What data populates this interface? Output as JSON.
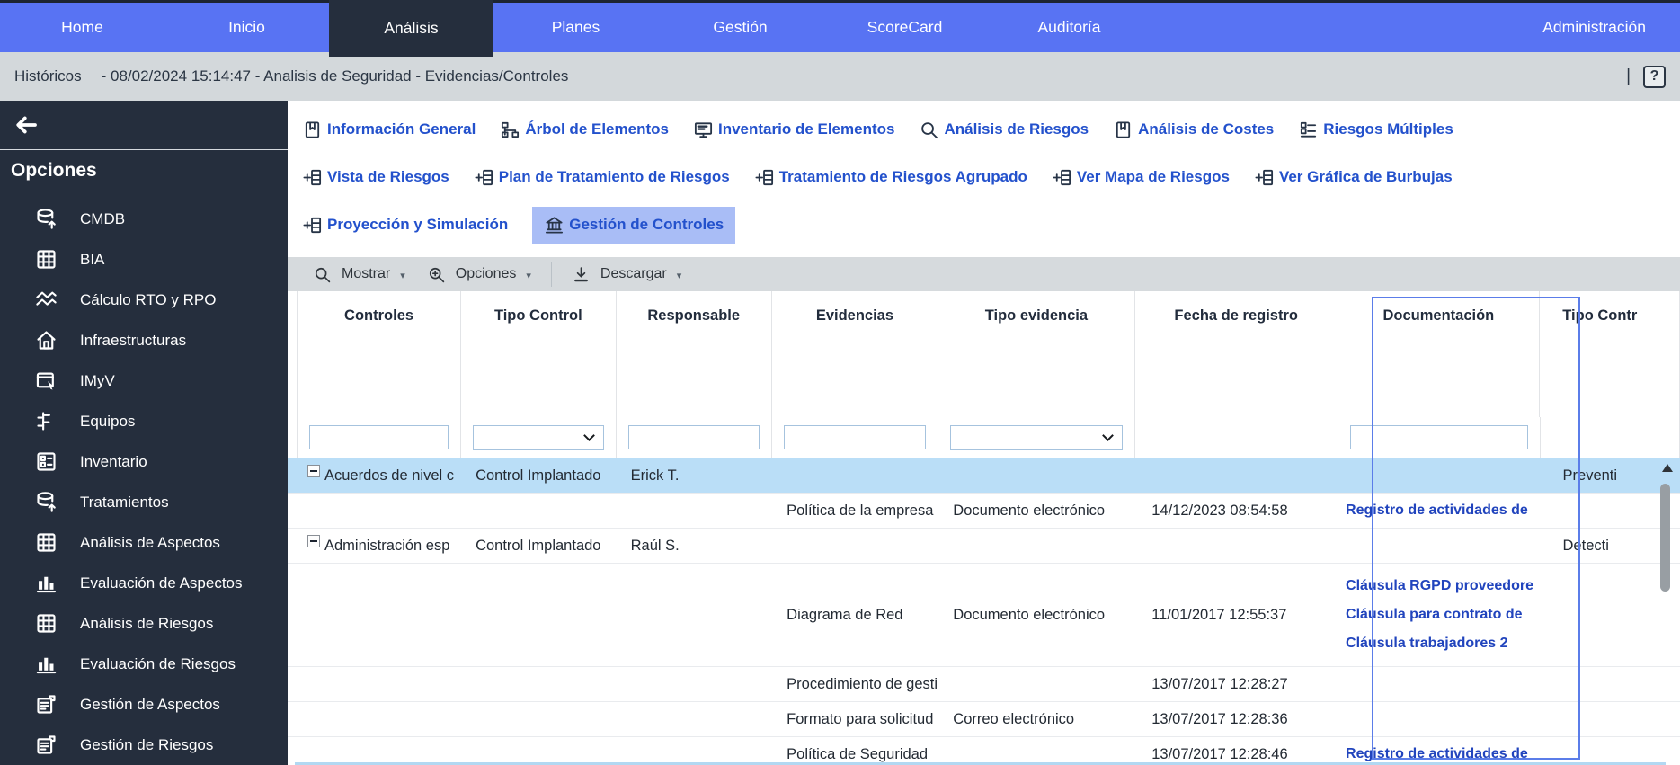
{
  "nav": {
    "items": [
      {
        "label": "Home"
      },
      {
        "label": "Inicio"
      },
      {
        "label": "Análisis",
        "active": true
      },
      {
        "label": "Planes"
      },
      {
        "label": "Gestión"
      },
      {
        "label": "ScoreCard"
      },
      {
        "label": "Auditoría"
      },
      {
        "label": "Administración",
        "right": true
      }
    ]
  },
  "breadcrumb": {
    "section": "Históricos",
    "detail": "- 08/02/2024 15:14:47 - Analisis de Seguridad - Evidencias/Controles",
    "separator": "|",
    "help_label": "?"
  },
  "sidebar": {
    "title": "Opciones",
    "items": [
      {
        "label": "CMDB",
        "icon": "database"
      },
      {
        "label": "BIA",
        "icon": "grid"
      },
      {
        "label": "Cálculo RTO y RPO",
        "icon": "trend"
      },
      {
        "label": "Infraestructuras",
        "icon": "home"
      },
      {
        "label": "IMyV",
        "icon": "calendar-cursor"
      },
      {
        "label": "Equipos",
        "icon": "hierarchy"
      },
      {
        "label": "Inventario",
        "icon": "checklist"
      },
      {
        "label": "Tratamientos",
        "icon": "database"
      },
      {
        "label": "Análisis de Aspectos",
        "icon": "grid"
      },
      {
        "label": "Evaluación de Aspectos",
        "icon": "barchart"
      },
      {
        "label": "Análisis de Riesgos",
        "icon": "grid"
      },
      {
        "label": "Evaluación de Riesgos",
        "icon": "barchart"
      },
      {
        "label": "Gestión de Aspectos",
        "icon": "doc-report"
      },
      {
        "label": "Gestión de Riesgos",
        "icon": "doc-report"
      }
    ]
  },
  "tabs": {
    "rows": [
      [
        {
          "label": "Información General",
          "icon": "book"
        },
        {
          "label": "Árbol de Elementos",
          "icon": "tree"
        },
        {
          "label": "Inventario de Elementos",
          "icon": "monitor"
        },
        {
          "label": "Análisis de Riesgos",
          "icon": "magnifier"
        },
        {
          "label": "Análisis de Costes",
          "icon": "book"
        },
        {
          "label": "Riesgos Múltiples",
          "icon": "list-grid"
        }
      ],
      [
        {
          "label": "Vista de Riesgos",
          "icon": "plus-window"
        },
        {
          "label": "Plan de Tratamiento de Riesgos",
          "icon": "plus-window"
        },
        {
          "label": "Tratamiento de Riesgos Agrupado",
          "icon": "plus-window"
        },
        {
          "label": "Ver Mapa de Riesgos",
          "icon": "plus-window"
        },
        {
          "label": "Ver Gráfica de Burbujas",
          "icon": "plus-window"
        }
      ],
      [
        {
          "label": "Proyección y Simulación",
          "icon": "plus-window"
        },
        {
          "label": "Gestión de Controles",
          "icon": "bank",
          "selected": true
        }
      ]
    ]
  },
  "toolbar": {
    "items": [
      {
        "label": "Mostrar",
        "icon": "magnifier",
        "caret": "▾"
      },
      {
        "label": "Opciones",
        "icon": "magnifier-plus",
        "caret": "▾"
      },
      {
        "label": "Descargar",
        "icon": "download",
        "caret": "▾",
        "separator_before": true
      }
    ]
  },
  "table": {
    "columns": [
      {
        "label": "Controles",
        "filter": "input"
      },
      {
        "label": "Tipo Control",
        "filter": "select"
      },
      {
        "label": "Responsable",
        "filter": "input"
      },
      {
        "label": "Evidencias",
        "filter": "input"
      },
      {
        "label": "Tipo evidencia",
        "filter": "select"
      },
      {
        "label": "Fecha de registro",
        "filter": "none"
      },
      {
        "label": "Documentación",
        "filter": "input",
        "highlighted": true
      },
      {
        "label": "Tipo Contr",
        "filter": "none",
        "cut": true
      }
    ],
    "rows": [
      {
        "kind": "control",
        "selected": true,
        "controles": "Acuerdos de nivel c",
        "tipo_control": "Control Implantado",
        "responsable": "Erick T.",
        "tipo_contr2": "Preventi"
      },
      {
        "kind": "evidence",
        "evidencias": "Política de la empresa",
        "tipo_evidencia": "Documento electrónico",
        "fecha": "14/12/2023 08:54:58",
        "docs": [
          "Registro de actividades de"
        ]
      },
      {
        "kind": "control",
        "controles": "Administración esp",
        "tipo_control": "Control Implantado",
        "responsable": "Raúl S.",
        "tipo_contr2": "Detecti"
      },
      {
        "kind": "evidence",
        "tall": true,
        "evidencias": "Diagrama de Red",
        "tipo_evidencia": "Documento electrónico",
        "fecha": "11/01/2017 12:55:37",
        "docs": [
          "Cláusula RGPD proveedore",
          "Cláusula para contrato de",
          "Cláusula trabajadores 2"
        ]
      },
      {
        "kind": "evidence",
        "evidencias": "Procedimiento de gesti",
        "tipo_evidencia": "",
        "fecha": "13/07/2017 12:28:27",
        "docs": []
      },
      {
        "kind": "evidence",
        "evidencias": "Formato para solicitud",
        "tipo_evidencia": "Correo electrónico",
        "fecha": "13/07/2017 12:28:36",
        "docs": []
      },
      {
        "kind": "evidence",
        "evidencias": "Política de Seguridad",
        "tipo_evidencia": "",
        "fecha": "13/07/2017 12:28:46",
        "docs": [
          "Registro de actividades de"
        ]
      }
    ]
  },
  "colors": {
    "nav_blue": "#5873f3",
    "active_dark": "#252e3d",
    "breadcrumb_bg": "#d3d8db",
    "tab_link_blue": "#2351cc",
    "selected_tab_bg": "#a9bdf6",
    "toolbar_bg": "#d6dadd",
    "selected_row_bg": "#badef7",
    "doc_column_border": "#5b7de9",
    "doc_link_blue": "#2144bd"
  }
}
